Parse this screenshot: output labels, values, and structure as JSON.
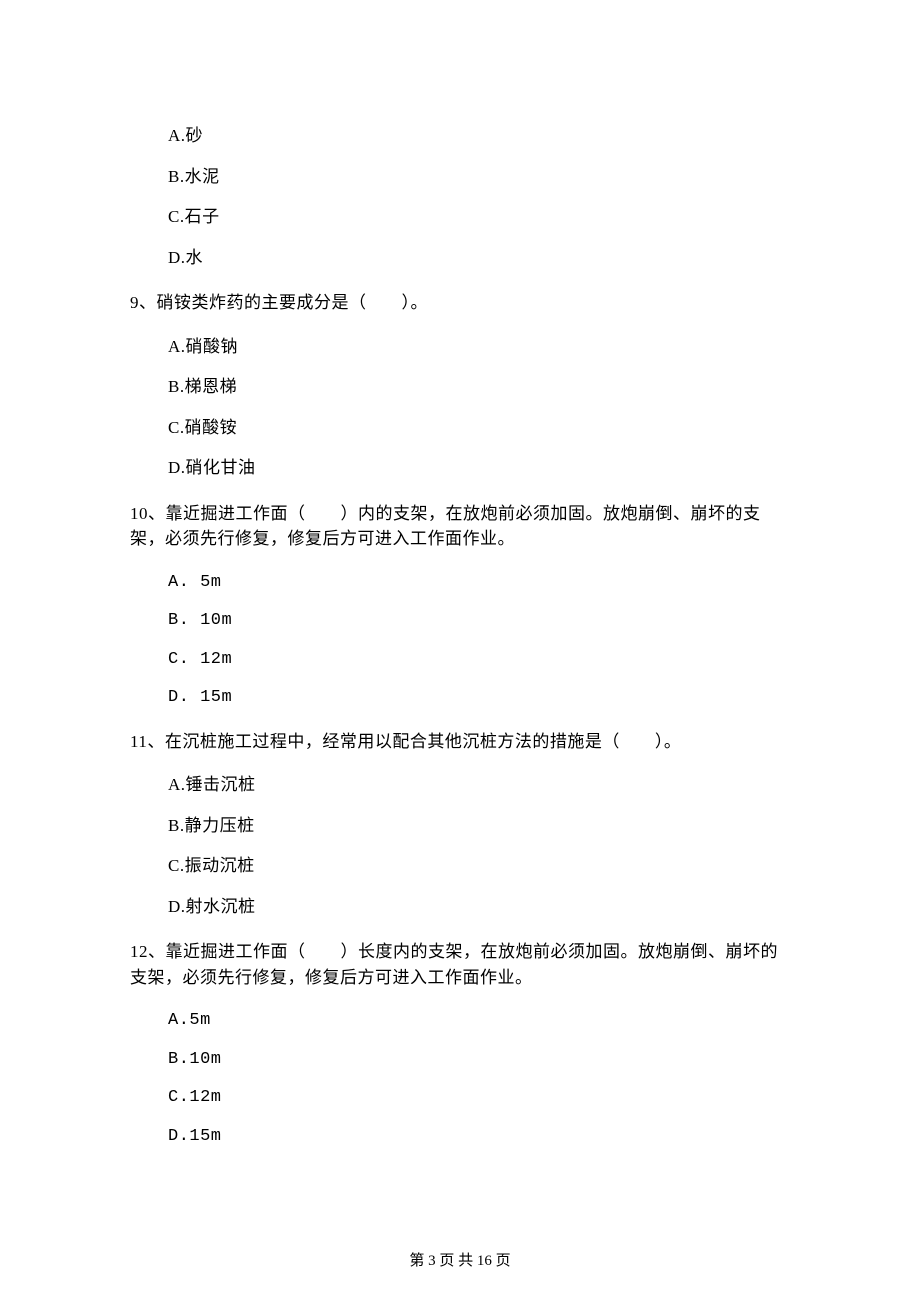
{
  "q8_options": {
    "a": "A.砂",
    "b": "B.水泥",
    "c": "C.石子",
    "d": "D.水"
  },
  "q9": {
    "stem": "9、硝铵类炸药的主要成分是（　　）。",
    "a": "A.硝酸钠",
    "b": "B.梯恩梯",
    "c": "C.硝酸铵",
    "d": "D.硝化甘油"
  },
  "q10": {
    "stem": "10、靠近掘进工作面（　　）内的支架，在放炮前必须加固。放炮崩倒、崩坏的支架，必须先行修复，修复后方可进入工作面作业。",
    "a": "A.  5m",
    "b": "B.  10m",
    "c": "C.  12m",
    "d": "D.  15m"
  },
  "q11": {
    "stem": "11、在沉桩施工过程中，经常用以配合其他沉桩方法的措施是（　　）。",
    "a": "A.锤击沉桩",
    "b": "B.静力压桩",
    "c": "C.振动沉桩",
    "d": "D.射水沉桩"
  },
  "q12": {
    "stem": "12、靠近掘进工作面（　　）长度内的支架，在放炮前必须加固。放炮崩倒、崩坏的支架，必须先行修复，修复后方可进入工作面作业。",
    "a": "A.5m",
    "b": "B.10m",
    "c": "C.12m",
    "d": "D.15m"
  },
  "footer": "第 3 页 共 16 页"
}
